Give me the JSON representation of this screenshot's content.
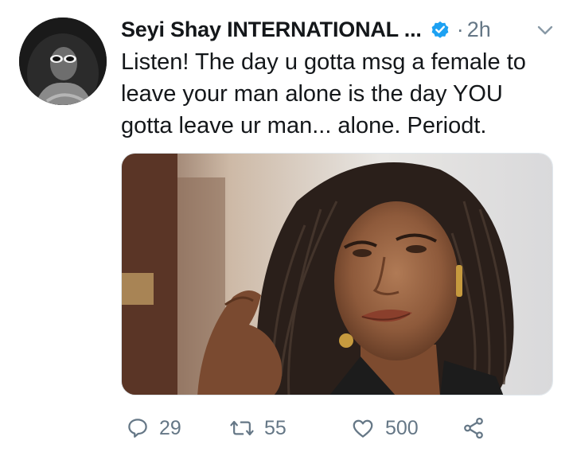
{
  "tweet": {
    "display_name": "Seyi Shay INTERNATIONAL ...",
    "verified": true,
    "dot": "·",
    "time": "2h",
    "text": "Listen! The day u gotta msg a female to leave your man alone is the day YOU gotta leave ur man... alone. Periodt."
  },
  "actions": {
    "reply_count": "29",
    "retweet_count": "55",
    "like_count": "500"
  },
  "icons": {
    "verified": "verified-badge-icon",
    "caret": "chevron-down-icon",
    "reply": "reply-icon",
    "retweet": "retweet-icon",
    "like": "heart-icon",
    "share": "share-icon"
  },
  "colors": {
    "text_primary": "#14171a",
    "text_secondary": "#657786",
    "verified_blue": "#1da1f2"
  }
}
